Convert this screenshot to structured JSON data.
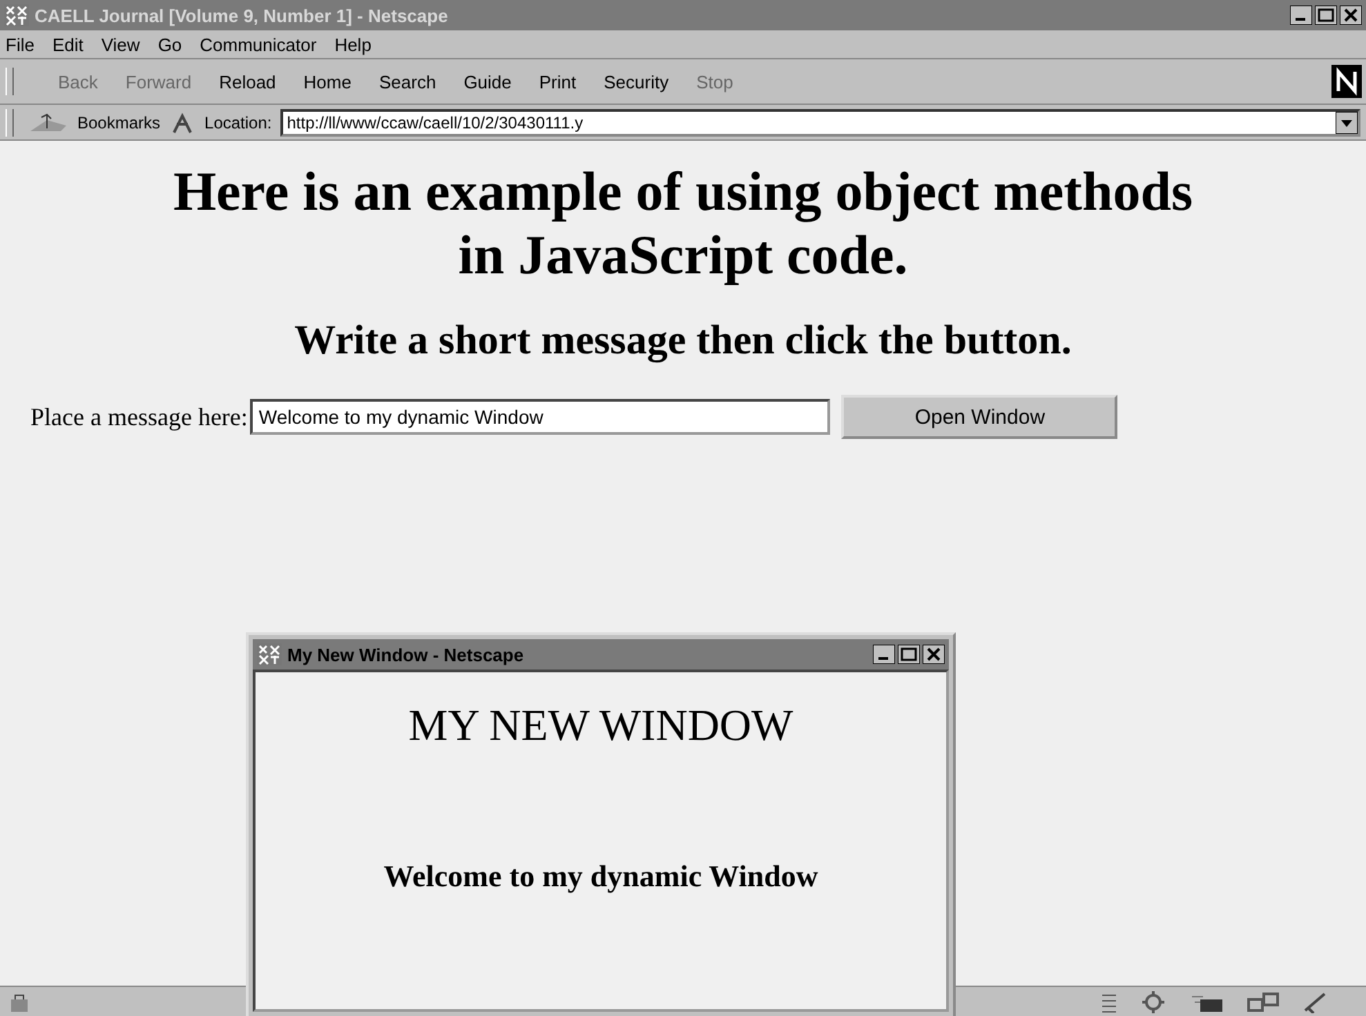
{
  "window": {
    "title": "CAELL Journal [Volume 9, Number 1] - Netscape"
  },
  "menu": [
    "File",
    "Edit",
    "View",
    "Go",
    "Communicator",
    "Help"
  ],
  "toolbar": [
    {
      "label": "Back",
      "disabled": true
    },
    {
      "label": "Forward",
      "disabled": true
    },
    {
      "label": "Reload",
      "disabled": false
    },
    {
      "label": "Home",
      "disabled": false
    },
    {
      "label": "Search",
      "disabled": false
    },
    {
      "label": "Guide",
      "disabled": false
    },
    {
      "label": "Print",
      "disabled": false
    },
    {
      "label": "Security",
      "disabled": false
    },
    {
      "label": "Stop",
      "disabled": true
    }
  ],
  "location_bar": {
    "bookmarks": "Bookmarks",
    "label": "Location:",
    "url": "http://ll/www/ccaw/caell/10/2/30430111.y"
  },
  "page": {
    "heading": "Here is an example of using object methods in JavaScript code.",
    "subheading": "Write a short message then click the button.",
    "field_label": "Place a message here:",
    "field_value": "Welcome to my dynamic Window",
    "button": "Open Window"
  },
  "popup": {
    "title": "My New Window - Netscape",
    "heading": "MY NEW WINDOW",
    "message": "Welcome to my dynamic Window"
  }
}
